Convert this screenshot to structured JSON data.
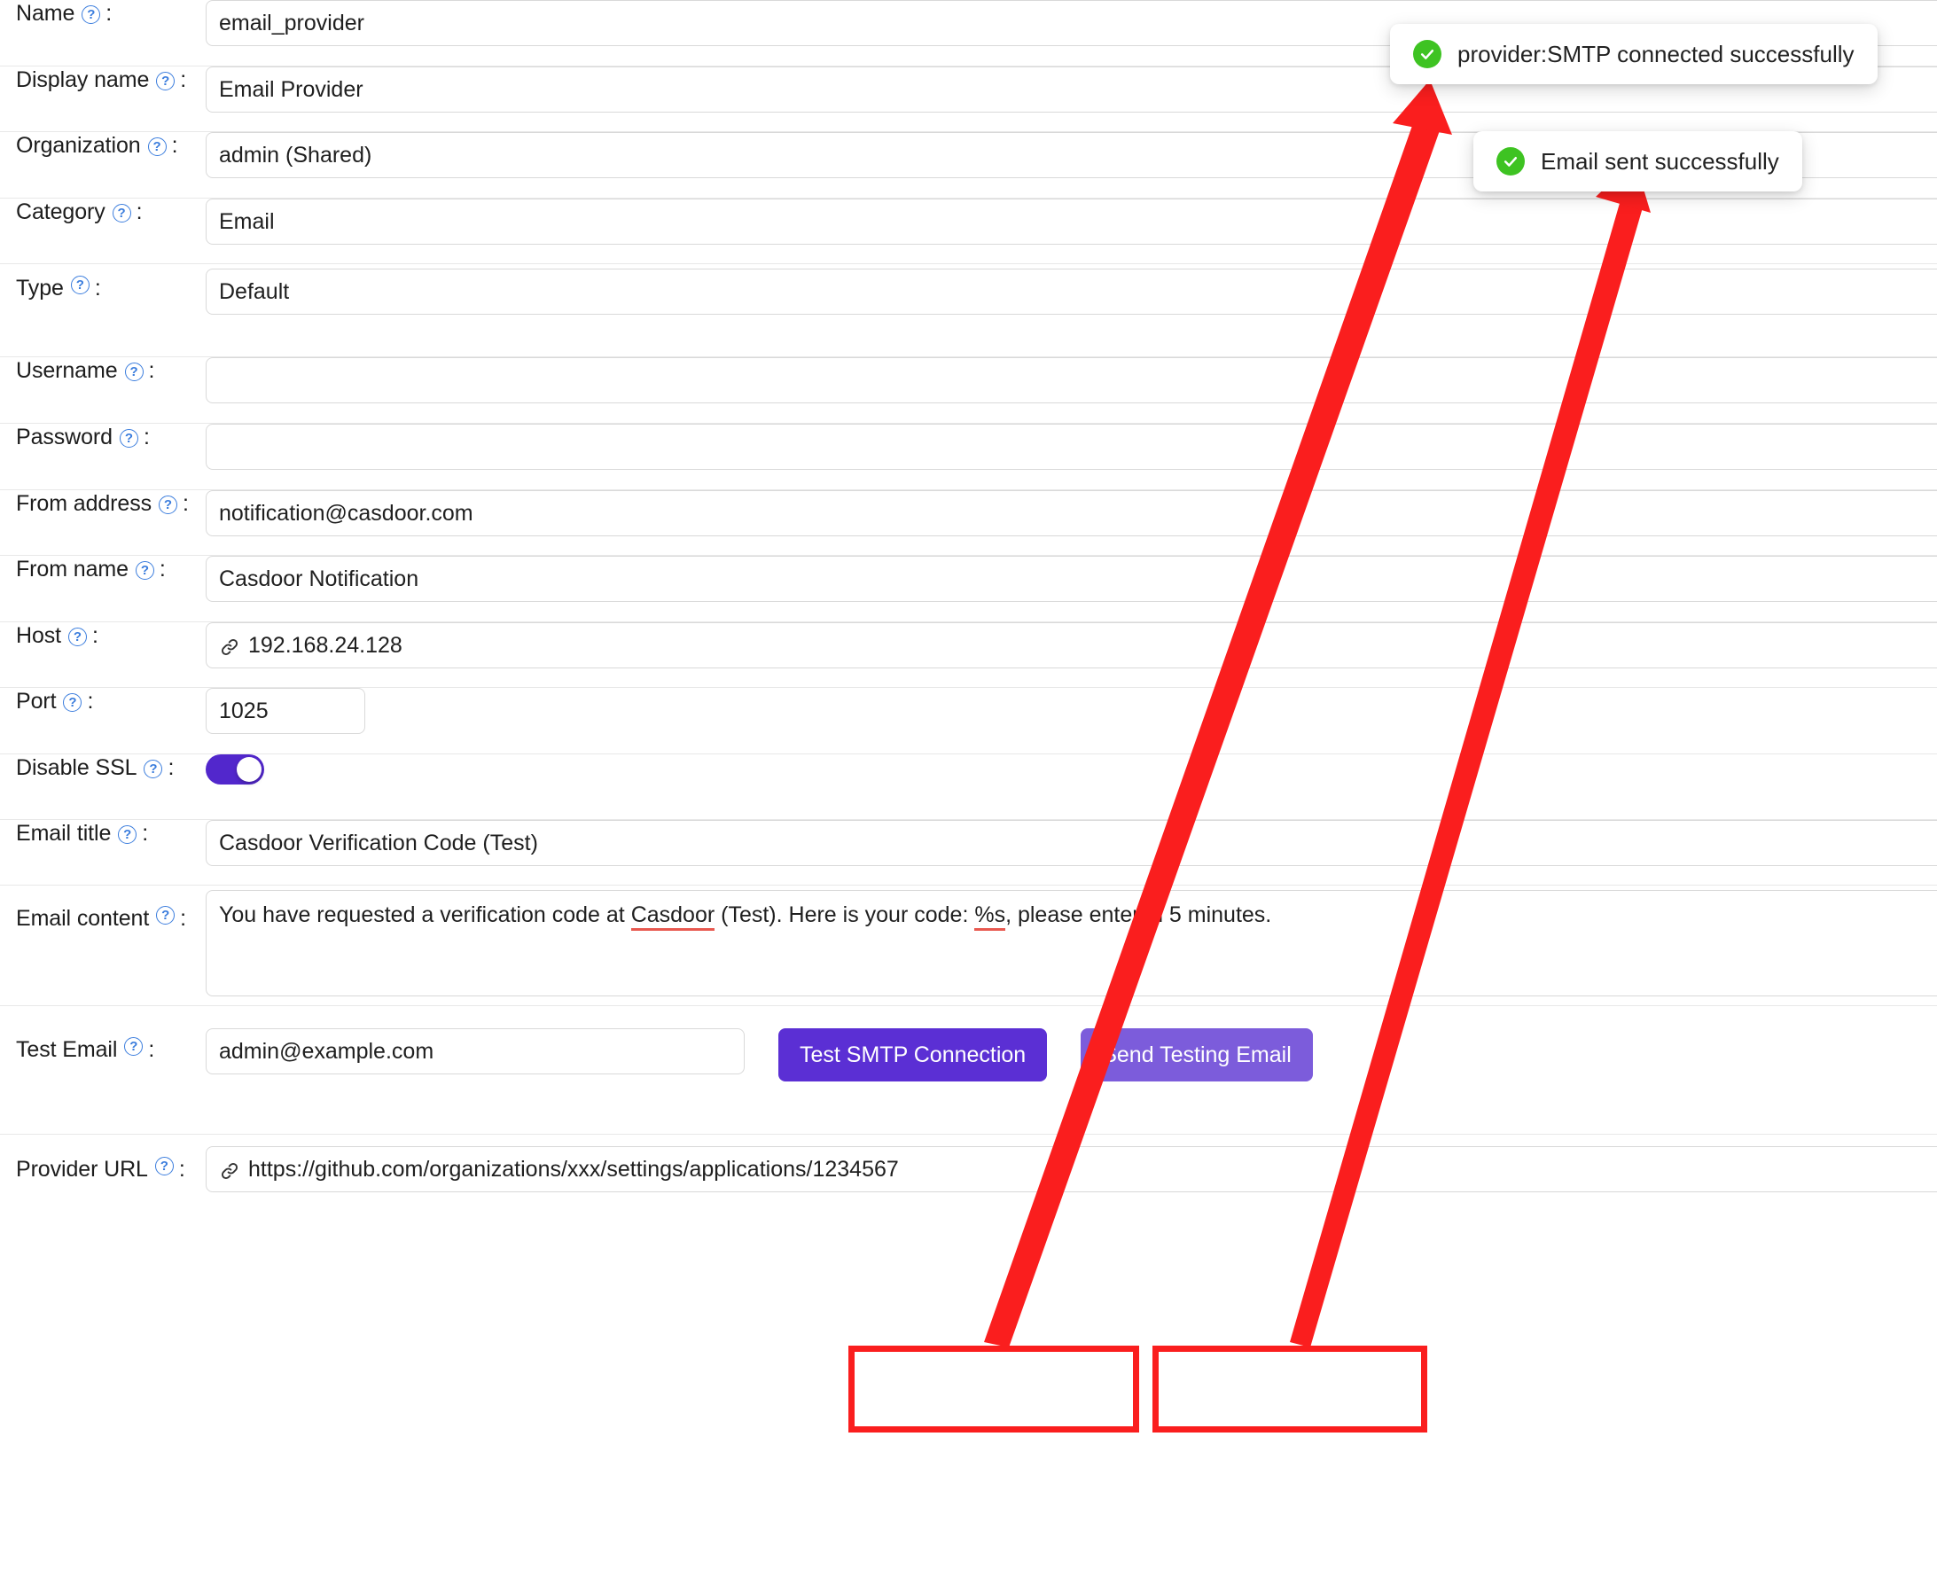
{
  "form": {
    "colon": ":",
    "help_icon": "question-circle-icon",
    "link_icon": "link-icon",
    "fields": [
      {
        "label": "Name",
        "value": "email_provider"
      },
      {
        "label": "Display name",
        "value": "Email Provider"
      },
      {
        "label": "Organization",
        "value": "admin (Shared)"
      },
      {
        "label": "Category",
        "value": "Email"
      },
      {
        "label": "Type",
        "value": "Default"
      },
      {
        "label": "Username",
        "value": ""
      },
      {
        "label": "Password",
        "value": ""
      },
      {
        "label": "From address",
        "value": "notification@casdoor.com"
      },
      {
        "label": "From name",
        "value": "Casdoor  Notification"
      },
      {
        "label": "Host",
        "value": "192.168.24.128"
      },
      {
        "label": "Port",
        "value": "1025"
      },
      {
        "label": "Disable SSL",
        "value": "on"
      },
      {
        "label": "Email title",
        "value": "Casdoor Verification Code (Test)"
      },
      {
        "label": "Email content",
        "value": "You have requested a verification code at Casdoor (Test). Here is your code: %s, please enter in 5 minutes."
      },
      {
        "label": "Test Email",
        "value": "admin@example.com"
      },
      {
        "label": "Provider URL",
        "value": "https://github.com/organizations/xxx/settings/applications/1234567"
      }
    ],
    "email_content_parts": {
      "p1": "You have requested a verification code at ",
      "misspelled1": "Casdoor",
      "p2": " (Test). Here is your code: ",
      "misspelled2": "%s",
      "p3": ", please enter in 5 minutes."
    }
  },
  "buttons": {
    "test_smtp": "Test SMTP Connection",
    "send_testing_email": "Send Testing Email"
  },
  "toasts": [
    {
      "icon": "check-circle-icon",
      "message": "provider:SMTP connected successfully"
    },
    {
      "icon": "check-circle-icon",
      "message": "Email sent successfully"
    }
  ],
  "colors": {
    "primary_button": "#5b2fd4",
    "secondary_button": "#7c5cdb",
    "toggle_on": "#5227cc",
    "success": "#3ec322",
    "annotation_red": "#fa1e1e",
    "help_icon_blue": "#3b7ddd",
    "spellcheck_red": "#e8584f"
  }
}
